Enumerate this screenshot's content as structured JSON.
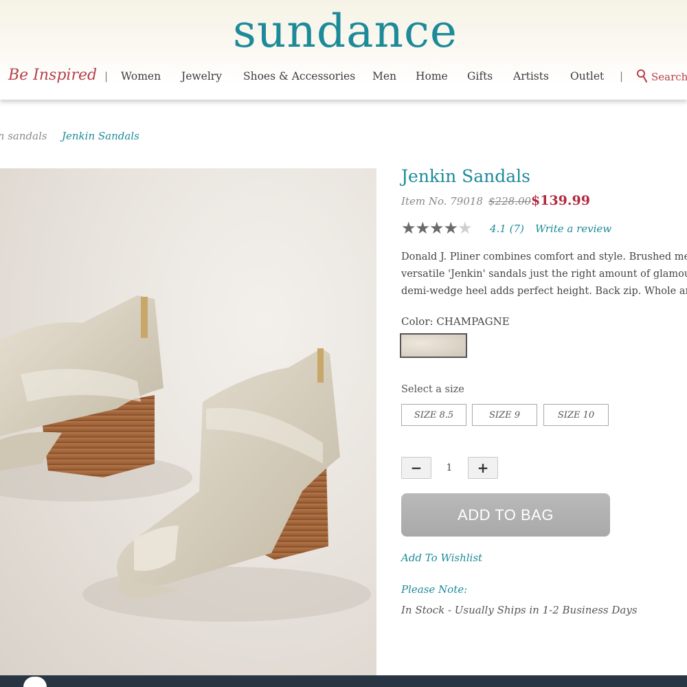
{
  "brand": {
    "logo_text": "sundance",
    "tagline": "Be Inspired",
    "accent_color": "#1d8a99",
    "sale_color": "#b2283d"
  },
  "nav": {
    "items": [
      "Women",
      "Jewelry",
      "Shoes & Accessories",
      "Men",
      "Home",
      "Gifts",
      "Artists",
      "Outlet"
    ],
    "search_label": "Search",
    "search_icon": "search-icon"
  },
  "breadcrumb": [
    "in sandals",
    "Jenkin Sandals"
  ],
  "product": {
    "title": "Jenkin Sandals",
    "item_number": "Item No. 79018",
    "original_price": "$228.00",
    "sale_price": "$139.99",
    "rating_value": 4.1,
    "rating_max": 5,
    "rating_text": "4.1 (7)",
    "write_review": "Write a review",
    "description_lines": [
      "Donald J. Pliner combines comfort and style. Brushed met",
      "versatile 'Jenkin' sandals just the right amount of glamour",
      "demi-wedge heel adds perfect height. Back zip. Whole and"
    ],
    "color_label": "Color: CHAMPAGNE",
    "size_label": "Select a size",
    "sizes": [
      "SIZE 8.5",
      "SIZE 9",
      "SIZE 10"
    ],
    "quantity": "1",
    "minus": "−",
    "plus": "+",
    "add_to_bag": "ADD TO BAG",
    "wishlist": "Add To Wishlist",
    "note_label": "Please Note:",
    "stock_status": "In Stock - Usually Ships in 1-2 Business Days"
  }
}
